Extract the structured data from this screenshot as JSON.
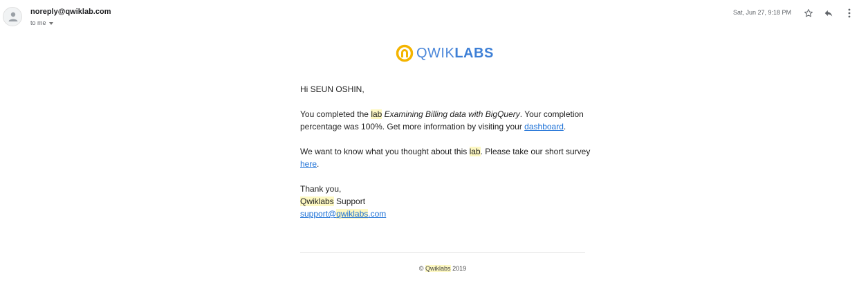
{
  "header": {
    "sender": "noreply@qwiklab.com",
    "recipient": "to me",
    "timestamp": "Sat, Jun 27, 9:18 PM",
    "icons": [
      "star-icon",
      "reply-icon",
      "more-vert-icon"
    ]
  },
  "logo": {
    "text_light": "QWIK",
    "text_bold": "LABS",
    "color_ring": "#f4b400",
    "color_text": "#4a86d9"
  },
  "message": {
    "greeting": "Hi SEUN OSHIN,",
    "p1_a": "You completed the ",
    "p1_lab": "lab",
    "p1_space": " ",
    "p1_title": "Examining Billing data with BigQuery",
    "p1_b": ". Your completion percentage was 100%. Get more information by visiting your ",
    "p1_link": "dashboard",
    "p1_end": ".",
    "p2_a": "We want to know what you thought about this ",
    "p2_lab": "lab",
    "p2_b": ". Please take our short survey ",
    "p2_link": "here",
    "p2_end": ".",
    "thanks": "Thank you,",
    "sig_brand": "Qwiklabs",
    "sig_rest": " Support",
    "email_a": "support@",
    "email_b": "qwiklabs",
    "email_c": ".com"
  },
  "footer": {
    "copy": "© ",
    "brand": "Qwiklabs",
    "year": " 2019"
  },
  "colors": {
    "highlight": "#fdf8c2",
    "link": "#1a6fd6"
  }
}
